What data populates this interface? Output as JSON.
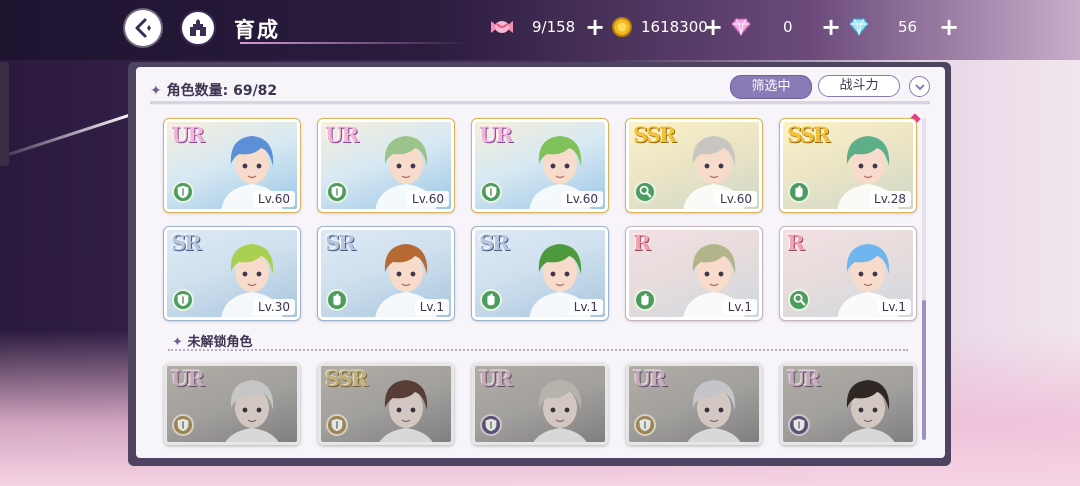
{
  "header": {
    "title": "育成",
    "resources": [
      {
        "icon": "candy-icon",
        "value": "9/158"
      },
      {
        "icon": "gold-coin-icon",
        "value": "1618300"
      },
      {
        "icon": "pink-diamond-icon",
        "value": "0"
      },
      {
        "icon": "blue-diamond-icon",
        "value": "56"
      }
    ],
    "plus": "+"
  },
  "panel": {
    "count_label": "角色数量: 69/82",
    "filter_button": "筛选中",
    "power_button": "战斗力",
    "unowned_label": "未解锁角色"
  },
  "owned_cards": [
    {
      "rarity": "UR",
      "level": "Lv.60",
      "class": "shield",
      "hair": "#5b8fd6"
    },
    {
      "rarity": "UR",
      "level": "Lv.60",
      "class": "shield",
      "hair": "#9bc48a"
    },
    {
      "rarity": "UR",
      "level": "Lv.60",
      "class": "shield",
      "hair": "#7fc25a"
    },
    {
      "rarity": "SSR",
      "level": "Lv.60",
      "class": "magnifier",
      "hair": "#c9c6c2"
    },
    {
      "rarity": "SSR",
      "level": "Lv.28",
      "class": "glove",
      "hair": "#5fae8a"
    },
    {
      "rarity": "SR",
      "level": "Lv.30",
      "class": "shield",
      "hair": "#a9d14f"
    },
    {
      "rarity": "SR",
      "level": "Lv.1",
      "class": "glove",
      "hair": "#b56a34"
    },
    {
      "rarity": "SR",
      "level": "Lv.1",
      "class": "glove",
      "hair": "#4d9a3c"
    },
    {
      "rarity": "R",
      "level": "Lv.1",
      "class": "glove",
      "hair": "#b2b58a"
    },
    {
      "rarity": "R",
      "level": "Lv.1",
      "class": "magnifier",
      "hair": "#6fb6ee"
    }
  ],
  "locked_cards": [
    {
      "rarity": "UR",
      "class": "gold",
      "hair": "#dcdcdc"
    },
    {
      "rarity": "SSR",
      "class": "gold",
      "hair": "#7a3e2c"
    },
    {
      "rarity": "UR",
      "class": "purple",
      "hair": "#cfc7b3"
    },
    {
      "rarity": "UR",
      "class": "gold",
      "hair": "#d9d9e6"
    },
    {
      "rarity": "UR",
      "class": "purple",
      "hair": "#3a2a22"
    }
  ],
  "colors": {
    "panel_bg": "#f7f5f9",
    "accent": "#8a7ab6",
    "class_green": "#4c9b5f"
  }
}
